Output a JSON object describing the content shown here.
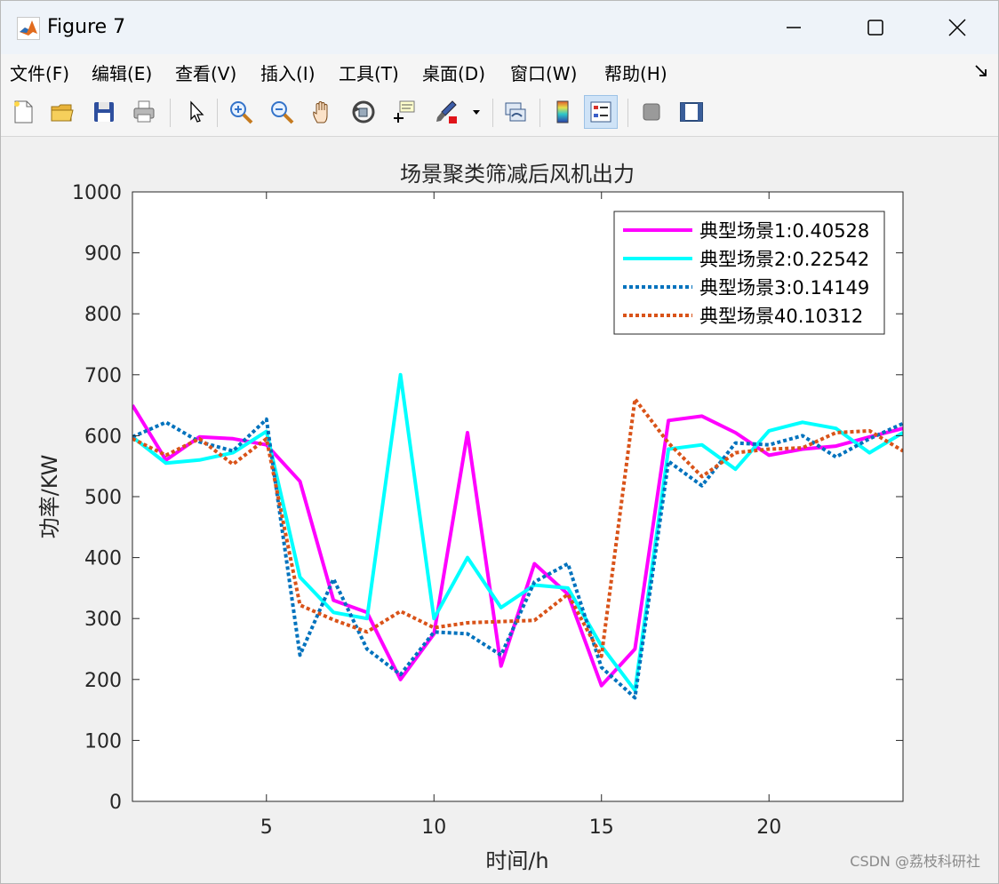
{
  "window": {
    "title": "Figure 7",
    "controls": {
      "minimize": "—",
      "maximize": "☐",
      "close": "✕"
    }
  },
  "menu": {
    "items": [
      "文件(F)",
      "编辑(E)",
      "查看(V)",
      "插入(I)",
      "工具(T)",
      "桌面(D)",
      "窗口(W)",
      "帮助(H)"
    ]
  },
  "toolbar": {
    "icons": [
      "new-figure-icon",
      "open-file-icon",
      "save-icon",
      "print-icon",
      "pointer-icon",
      "zoom-in-icon",
      "zoom-out-icon",
      "pan-hand-icon",
      "rotate-3d-icon",
      "data-cursor-icon",
      "brush-icon",
      "link-plot-icon",
      "colorbar-icon",
      "legend-icon",
      "hide-plot-tools-icon",
      "show-plot-tools-icon"
    ]
  },
  "watermark": "CSDN @荔枝科研社",
  "chart_data": {
    "type": "line",
    "title": "场景聚类筛减后风机出力",
    "xlabel": "时间/h",
    "ylabel": "功率/KW",
    "xlim": [
      1,
      24
    ],
    "ylim": [
      0,
      1000
    ],
    "xticks": [
      5,
      10,
      15,
      20
    ],
    "yticks": [
      0,
      100,
      200,
      300,
      400,
      500,
      600,
      700,
      800,
      900,
      1000
    ],
    "grid": false,
    "legend_position": "top-right",
    "x": [
      1,
      2,
      3,
      4,
      5,
      6,
      7,
      8,
      9,
      10,
      11,
      12,
      13,
      14,
      15,
      16,
      17,
      18,
      19,
      20,
      21,
      22,
      23,
      24
    ],
    "series": [
      {
        "name": "典型场景1:0.40528",
        "color": "#ff00ff",
        "style": "solid",
        "values": [
          650,
          560,
          598,
          595,
          585,
          525,
          330,
          310,
          200,
          275,
          605,
          222,
          390,
          340,
          190,
          250,
          625,
          632,
          605,
          568,
          578,
          583,
          598,
          612
        ]
      },
      {
        "name": "典型场景2:0.22542",
        "color": "#00ffff",
        "style": "solid",
        "values": [
          598,
          555,
          560,
          572,
          607,
          368,
          310,
          300,
          700,
          300,
          400,
          318,
          355,
          350,
          255,
          182,
          578,
          585,
          545,
          608,
          622,
          612,
          572,
          605
        ]
      },
      {
        "name": "典型场景3:0.14149",
        "color": "#0072bd",
        "style": "dotted",
        "values": [
          598,
          622,
          590,
          575,
          627,
          240,
          365,
          250,
          208,
          278,
          275,
          240,
          360,
          390,
          220,
          170,
          558,
          518,
          588,
          585,
          600,
          565,
          595,
          620
        ]
      },
      {
        "name": "典型场景40.10312",
        "color": "#d95319",
        "style": "dotted",
        "values": [
          595,
          568,
          595,
          553,
          595,
          322,
          298,
          278,
          312,
          285,
          293,
          295,
          297,
          340,
          238,
          660,
          588,
          533,
          572,
          578,
          580,
          605,
          608,
          575
        ]
      }
    ]
  }
}
